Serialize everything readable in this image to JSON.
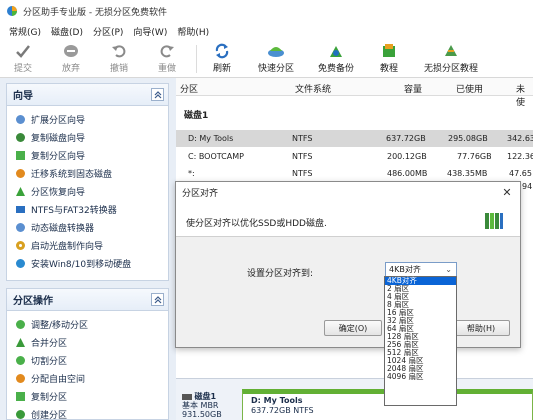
{
  "window": {
    "title": "分区助手专业版 - 无损分区免费软件"
  },
  "menu": [
    "常规(G)",
    "磁盘(D)",
    "分区(P)",
    "向导(W)",
    "帮助(H)"
  ],
  "toolbar": {
    "commit": "提交",
    "discard": "放弃",
    "undo": "撤销",
    "redo": "重做",
    "refresh": "刷新",
    "quick_partition": "快速分区",
    "free_backup": "免费备份",
    "tutorial": "教程",
    "lossless_tutorial": "无损分区教程"
  },
  "wizard_panel": {
    "title": "向导",
    "items": [
      "扩展分区向导",
      "复制磁盘向导",
      "复制分区向导",
      "迁移系统到固态磁盘",
      "分区恢复向导",
      "NTFS与FAT32转换器",
      "动态磁盘转换器",
      "启动光盘制作向导",
      "安装Win8/10到移动硬盘"
    ]
  },
  "partition_panel": {
    "title": "分区操作",
    "items": [
      "调整/移动分区",
      "合并分区",
      "切割分区",
      "分配自由空间",
      "复制分区",
      "创建分区"
    ]
  },
  "table": {
    "headers": [
      "分区",
      "文件系统",
      "容量",
      "已使用",
      "未使"
    ],
    "disk_label": "磁盘1",
    "rows": [
      {
        "name": "D: My Tools",
        "fs": "NTFS",
        "capacity": "637.72GB",
        "used": "295.08GB",
        "free": "342.63"
      },
      {
        "name": "C: BOOTCAMP",
        "fs": "NTFS",
        "capacity": "200.12GB",
        "used": "77.76GB",
        "free": "122.36"
      },
      {
        "name": "*:",
        "fs": "NTFS",
        "capacity": "486.00MB",
        "used": "438.35MB",
        "free": "47.65"
      }
    ],
    "row3_tail": "94"
  },
  "diskmap": {
    "disk_name": "磁盘1",
    "disk_type": "基本 MBR",
    "disk_size": "931.50GB",
    "partition_name": "D: My Tools",
    "partition_size": "637.72GB NTFS"
  },
  "dialog": {
    "title": "分区对齐",
    "close": "✕",
    "description": "使分区对齐以优化SSD或HDD磁盘.",
    "set_label": "设置分区对齐到:",
    "selected": "4KB对齐",
    "ok": "确定(O)",
    "help": "帮助(H)"
  },
  "dropdown": {
    "options": [
      "4KB对齐",
      "2 扇区",
      "4 扇区",
      "8 扇区",
      "16 扇区",
      "32 扇区",
      "64 扇区",
      "128 扇区",
      "256 扇区",
      "512 扇区",
      "1024 扇区",
      "2048 扇区",
      "4096 扇区"
    ],
    "selected_index": 0
  },
  "colors": {
    "accent": "#0a64d6",
    "panel_bg": "#e8eef6",
    "partition_green": "#62b034"
  }
}
